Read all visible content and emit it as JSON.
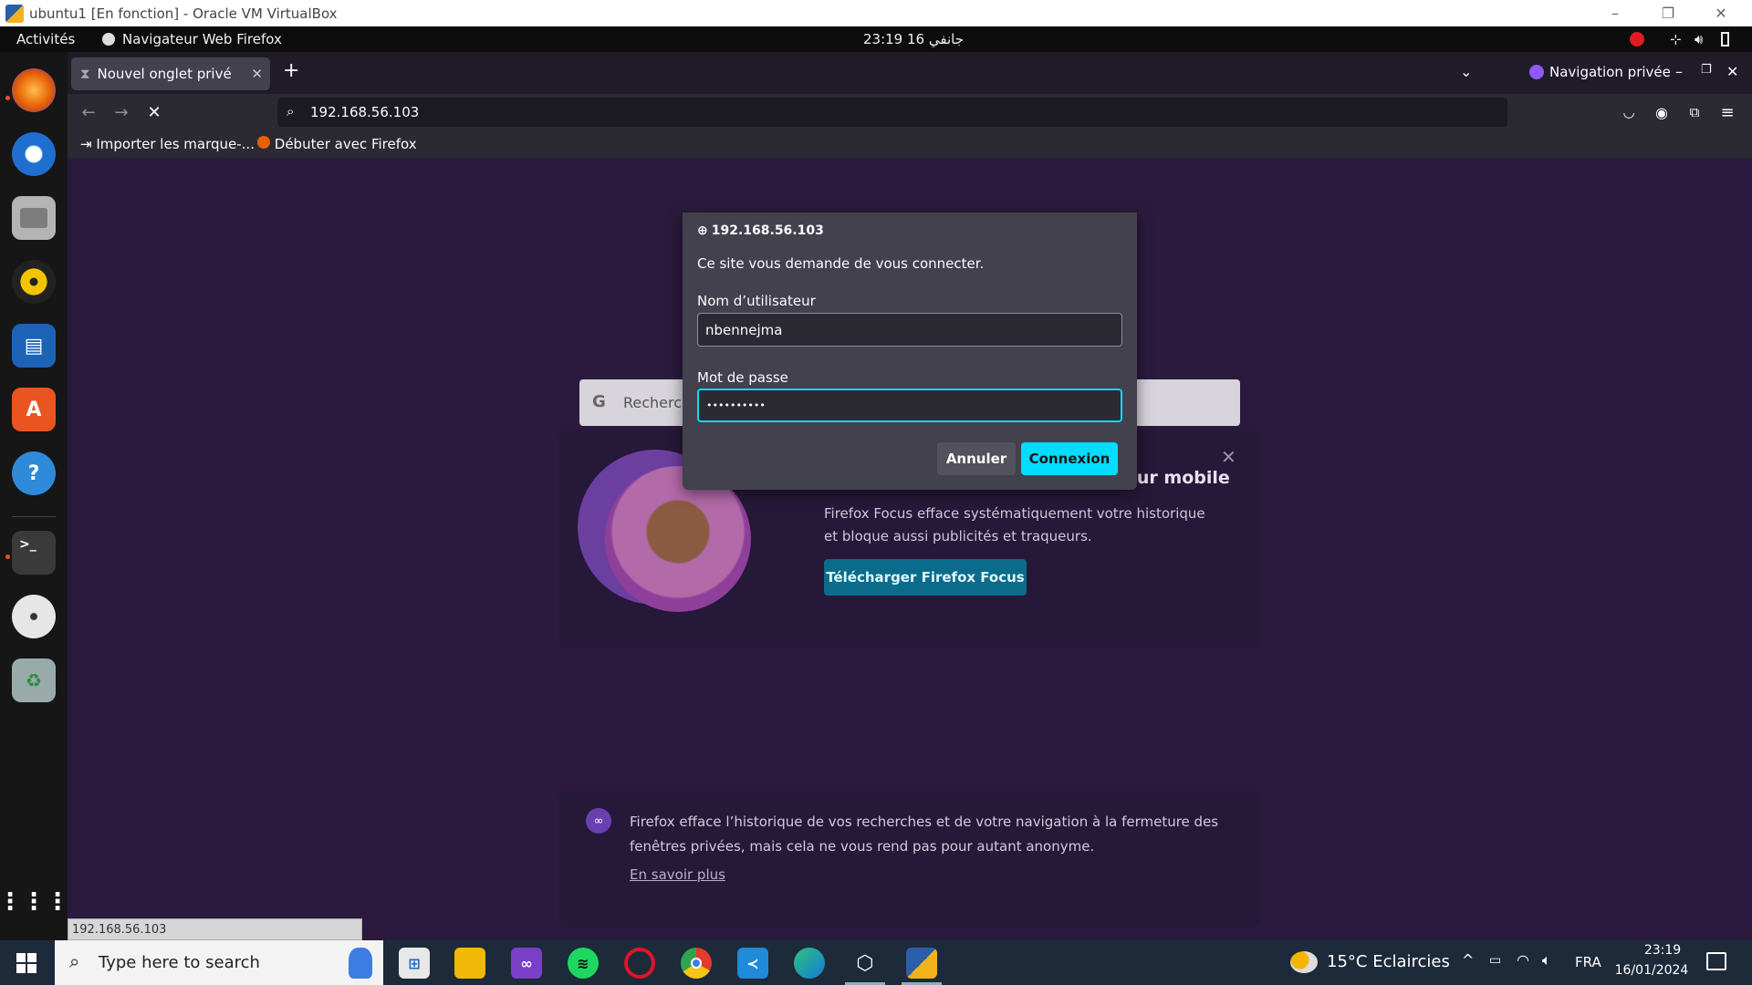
{
  "vbox": {
    "title": "ubuntu1 [En fonction] - Oracle VM VirtualBox"
  },
  "gnome": {
    "activities": "Activités",
    "app_label": "Navigateur Web Firefox",
    "clock": "23:19  16 جانفي"
  },
  "firefox": {
    "tab_title": "Nouvel onglet privé",
    "new_tab": "+",
    "private_label": "Navigation privée",
    "url": "192.168.56.103",
    "bookmarks": [
      "Importer les marque-...",
      "Débuter avec Firefox"
    ],
    "search_placeholder": "Recherche",
    "status_url": "192.168.56.103"
  },
  "dialog": {
    "host": "192.168.56.103",
    "message": "Ce site vous demande de vous connecter.",
    "username_label": "Nom d’utilisateur",
    "username_value": "nbennejma",
    "password_label": "Mot de passe",
    "password_mask": "••••••••••",
    "cancel": "Annuler",
    "login": "Connexion"
  },
  "promo": {
    "title": "Confidentialité de haut niveau sur mobile",
    "description": "Firefox Focus efface systématiquement votre historique et bloque aussi publicités et traqueurs.",
    "button": "Télécharger Firefox Focus"
  },
  "notice": {
    "text": "Firefox efface l’historique de vos recherches et de votre navigation à la fermeture des fenêtres privées, mais cela ne vous rend pas pour autant anonyme.",
    "link": "En savoir plus"
  },
  "taskbar": {
    "search_placeholder": "Type here to search",
    "weather": "15°C  Eclaircies",
    "language": "FRA",
    "time": "23:19",
    "date": "16/01/2024"
  },
  "colors": {
    "accent": "#00ddff",
    "private_bg": "#2b1a3d",
    "promo_button": "#0b6b8a"
  }
}
